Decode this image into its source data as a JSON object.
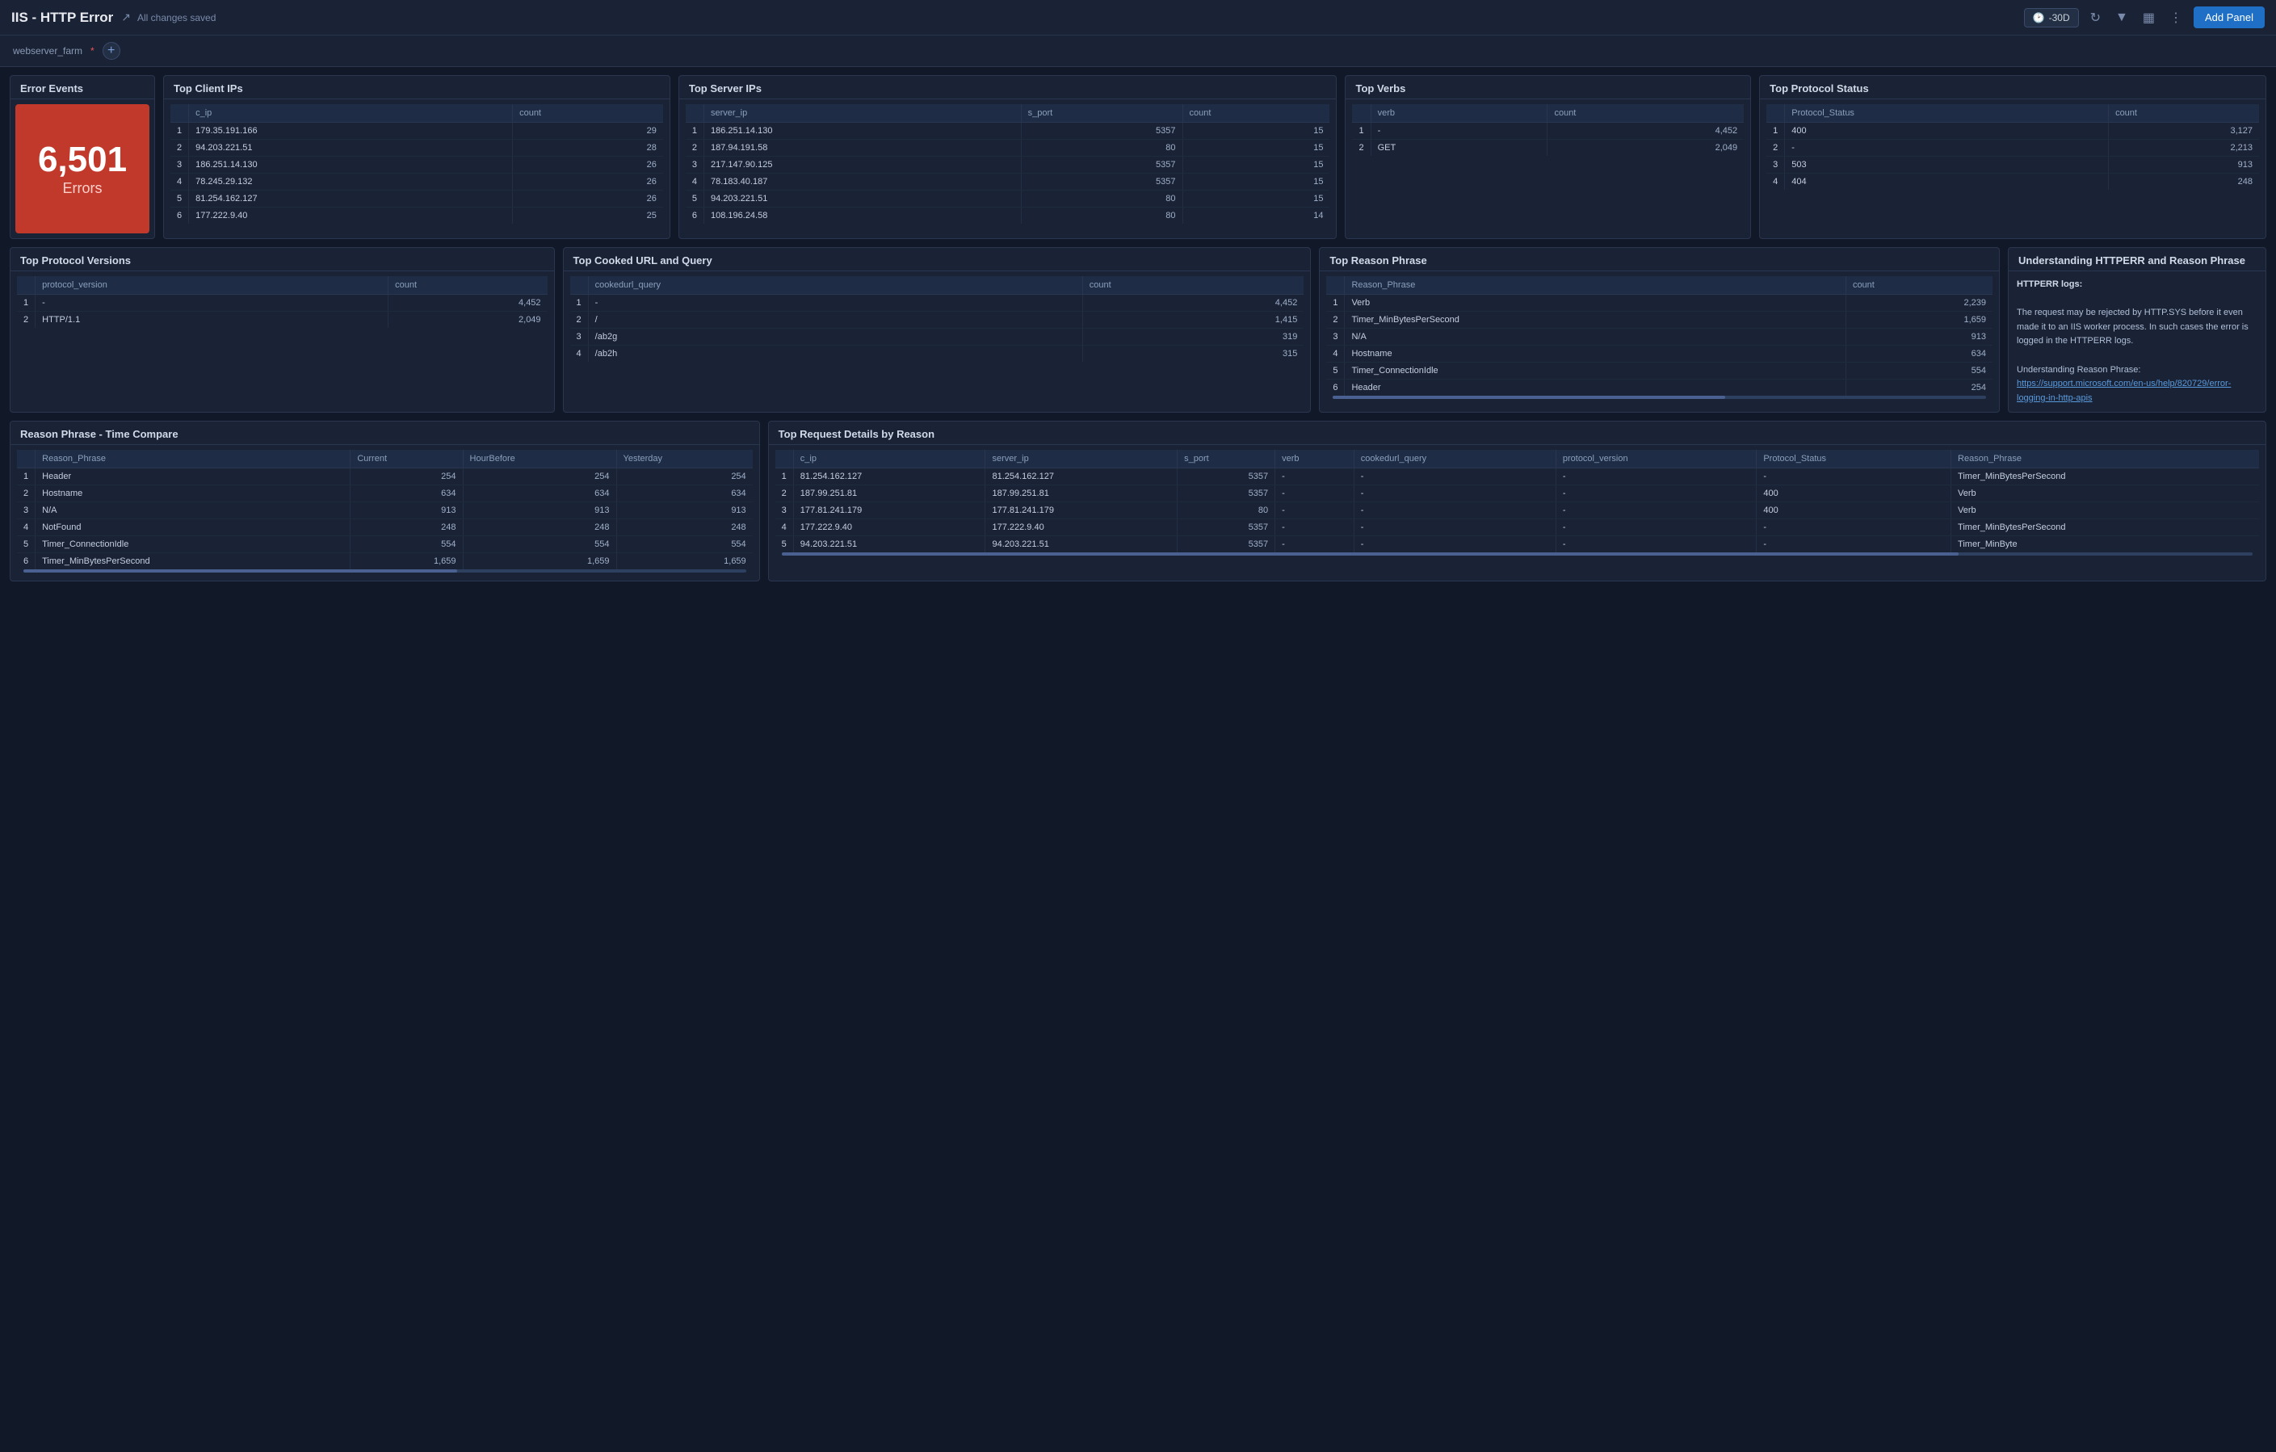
{
  "topbar": {
    "title": "IIS - HTTP Error",
    "saved_label": "All changes saved",
    "time_label": "-30D",
    "add_panel_label": "Add Panel"
  },
  "filterbar": {
    "label": "webserver_farm",
    "value": "*",
    "add_label": "+"
  },
  "panels": {
    "error_events": {
      "title": "Error Events",
      "count": "6,501",
      "sublabel": "Errors"
    },
    "top_client_ips": {
      "title": "Top Client IPs",
      "columns": [
        "c_ip",
        "count"
      ],
      "rows": [
        {
          "num": "1",
          "c_ip": "179.35.191.166",
          "count": "29"
        },
        {
          "num": "2",
          "c_ip": "94.203.221.51",
          "count": "28"
        },
        {
          "num": "3",
          "c_ip": "186.251.14.130",
          "count": "26"
        },
        {
          "num": "4",
          "c_ip": "78.245.29.132",
          "count": "26"
        },
        {
          "num": "5",
          "c_ip": "81.254.162.127",
          "count": "26"
        },
        {
          "num": "6",
          "c_ip": "177.222.9.40",
          "count": "25"
        }
      ]
    },
    "top_server_ips": {
      "title": "Top Server IPs",
      "columns": [
        "server_ip",
        "s_port",
        "count"
      ],
      "rows": [
        {
          "num": "1",
          "server_ip": "186.251.14.130",
          "s_port": "5357",
          "count": "15"
        },
        {
          "num": "2",
          "server_ip": "187.94.191.58",
          "s_port": "80",
          "count": "15"
        },
        {
          "num": "3",
          "server_ip": "217.147.90.125",
          "s_port": "5357",
          "count": "15"
        },
        {
          "num": "4",
          "server_ip": "78.183.40.187",
          "s_port": "5357",
          "count": "15"
        },
        {
          "num": "5",
          "server_ip": "94.203.221.51",
          "s_port": "80",
          "count": "15"
        },
        {
          "num": "6",
          "server_ip": "108.196.24.58",
          "s_port": "80",
          "count": "14"
        }
      ]
    },
    "top_verbs": {
      "title": "Top Verbs",
      "columns": [
        "verb",
        "count"
      ],
      "rows": [
        {
          "num": "1",
          "verb": "-",
          "count": "4,452"
        },
        {
          "num": "2",
          "verb": "GET",
          "count": "2,049"
        }
      ]
    },
    "top_protocol_status": {
      "title": "Top Protocol Status",
      "columns": [
        "Protocol_Status",
        "count"
      ],
      "rows": [
        {
          "num": "1",
          "status": "400",
          "count": "3,127"
        },
        {
          "num": "2",
          "status": "-",
          "count": "2,213"
        },
        {
          "num": "3",
          "status": "503",
          "count": "913"
        },
        {
          "num": "4",
          "status": "404",
          "count": "248"
        }
      ]
    },
    "top_protocol_versions": {
      "title": "Top Protocol Versions",
      "columns": [
        "protocol_version",
        "count"
      ],
      "rows": [
        {
          "num": "1",
          "version": "-",
          "count": "4,452"
        },
        {
          "num": "2",
          "version": "HTTP/1.1",
          "count": "2,049"
        }
      ]
    },
    "top_cooked_url": {
      "title": "Top Cooked URL and Query",
      "columns": [
        "cookedurl_query",
        "count"
      ],
      "rows": [
        {
          "num": "1",
          "url": "-",
          "count": "4,452"
        },
        {
          "num": "2",
          "url": "/",
          "count": "1,415"
        },
        {
          "num": "3",
          "url": "/ab2g",
          "count": "319"
        },
        {
          "num": "4",
          "url": "/ab2h",
          "count": "315"
        }
      ]
    },
    "top_reason_phrase": {
      "title": "Top Reason Phrase",
      "columns": [
        "Reason_Phrase",
        "count"
      ],
      "rows": [
        {
          "num": "1",
          "phrase": "Verb",
          "count": "2,239"
        },
        {
          "num": "2",
          "phrase": "Timer_MinBytesPerSecond",
          "count": "1,659"
        },
        {
          "num": "3",
          "phrase": "N/A",
          "count": "913"
        },
        {
          "num": "4",
          "phrase": "Hostname",
          "count": "634"
        },
        {
          "num": "5",
          "phrase": "Timer_ConnectionIdle",
          "count": "554"
        },
        {
          "num": "6",
          "phrase": "Header",
          "count": "254"
        }
      ]
    },
    "understanding": {
      "title": "Understanding HTTPERR and Reason Phrase",
      "intro": "HTTPERR logs:",
      "body": "The request may be rejected by HTTP.SYS before it even made it to an IIS worker process. In such cases the error is logged in the HTTPERR logs.",
      "link_text": "Understanding Reason Phrase: https://support.microsoft.com/en-us/help/820729/error-logging-in-http-apis",
      "link_url": "https://support.microsoft.com/en-us/help/820729/error-logging-in-http-apis"
    },
    "reason_phrase_time_compare": {
      "title": "Reason Phrase - Time Compare",
      "columns": [
        "Reason_Phrase",
        "Current",
        "HourBefore",
        "Yesterday"
      ],
      "rows": [
        {
          "num": "1",
          "phrase": "Header",
          "current": "254",
          "hour_before": "254",
          "yesterday": "254"
        },
        {
          "num": "2",
          "phrase": "Hostname",
          "current": "634",
          "hour_before": "634",
          "yesterday": "634"
        },
        {
          "num": "3",
          "phrase": "N/A",
          "current": "913",
          "hour_before": "913",
          "yesterday": "913"
        },
        {
          "num": "4",
          "phrase": "NotFound",
          "current": "248",
          "hour_before": "248",
          "yesterday": "248"
        },
        {
          "num": "5",
          "phrase": "Timer_ConnectionIdle",
          "current": "554",
          "hour_before": "554",
          "yesterday": "554"
        },
        {
          "num": "6",
          "phrase": "Timer_MinBytesPerSecond",
          "current": "1,659",
          "hour_before": "1,659",
          "yesterday": "1,659"
        }
      ]
    },
    "top_request_details": {
      "title": "Top Request Details by Reason",
      "columns": [
        "c_ip",
        "server_ip",
        "s_port",
        "verb",
        "cookedurl_query",
        "protocol_version",
        "Protocol_Status",
        "Reason_Phrase"
      ],
      "rows": [
        {
          "num": "1",
          "c_ip": "81.254.162.127",
          "server_ip": "81.254.162.127",
          "s_port": "5357",
          "verb": "-",
          "url": "-",
          "pv": "-",
          "ps": "-",
          "rp": "Timer_MinBytesPerSecond"
        },
        {
          "num": "2",
          "c_ip": "187.99.251.81",
          "server_ip": "187.99.251.81",
          "s_port": "5357",
          "verb": "-",
          "url": "-",
          "pv": "-",
          "ps": "400",
          "rp": "Verb"
        },
        {
          "num": "3",
          "c_ip": "177.81.241.179",
          "server_ip": "177.81.241.179",
          "s_port": "80",
          "verb": "-",
          "url": "-",
          "pv": "-",
          "ps": "400",
          "rp": "Verb"
        },
        {
          "num": "4",
          "c_ip": "177.222.9.40",
          "server_ip": "177.222.9.40",
          "s_port": "5357",
          "verb": "-",
          "url": "-",
          "pv": "-",
          "ps": "-",
          "rp": "Timer_MinBytesPerSecond"
        },
        {
          "num": "5",
          "c_ip": "94.203.221.51",
          "server_ip": "94.203.221.51",
          "s_port": "5357",
          "verb": "-",
          "url": "-",
          "pv": "-",
          "ps": "-",
          "rp": "Timer_MinByte"
        }
      ]
    }
  }
}
